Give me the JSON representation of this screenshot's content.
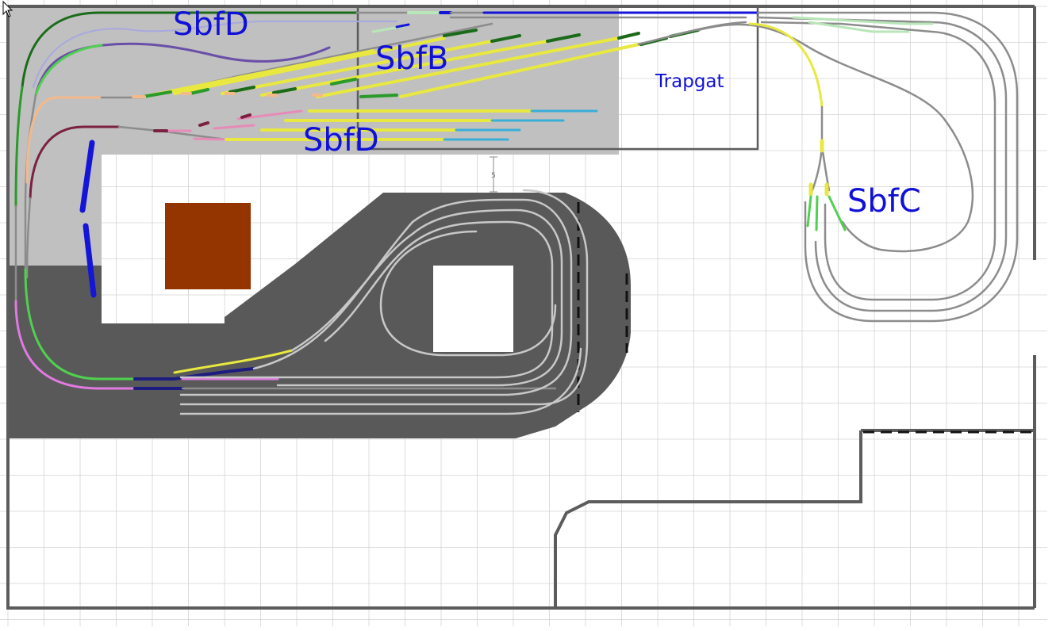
{
  "labels": {
    "sbfd_top": "SbfD",
    "sbfb": "SbfB",
    "sbfd_middle": "SbfD",
    "trapgat": "Trapgat",
    "sbfc": "SbfC",
    "dim_mark": "5"
  },
  "colors": {
    "background": "#ffffff",
    "grid": "#d4d4d4",
    "upper_level": "#c0c0c0",
    "lower_level": "#595959",
    "wall": "#5c5c5c",
    "track_grey": "#8c8c8c",
    "track_light": "#c8c8c8",
    "yellow": "#e8e840",
    "green": "#2a9a2a",
    "light_green": "#50d050",
    "pale_green": "#b8e6b8",
    "dark_green": "#1b6b1b",
    "blue": "#1515d8",
    "navy": "#1c1c80",
    "purple": "#6a4fa8",
    "lavender": "#a8a8e0",
    "peach": "#f4b98a",
    "maroon": "#7a2040",
    "pink": "#e88ab8",
    "violet": "#e07ae0",
    "cyan": "#3aaed8",
    "building": "#943500",
    "label_blue": "#1010d8"
  },
  "legend_items": []
}
